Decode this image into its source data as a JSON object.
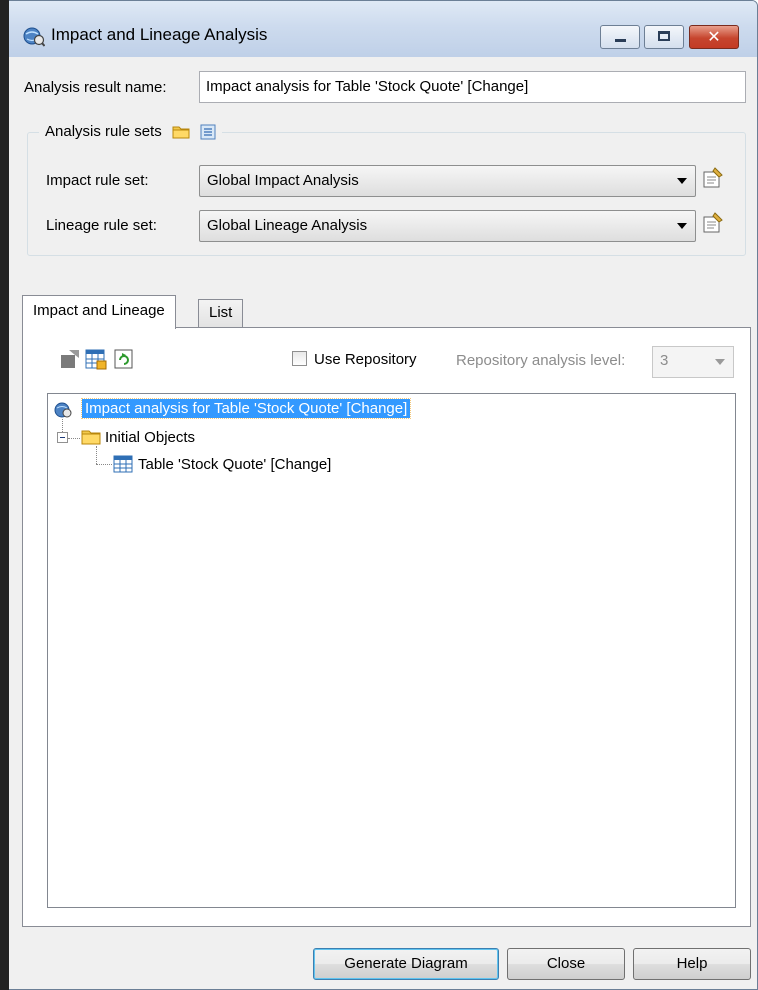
{
  "window": {
    "title": "Impact and Lineage Analysis",
    "close_glyph": "✕"
  },
  "form": {
    "result_name_label": "Analysis result name:",
    "result_name_value": "Impact analysis for Table 'Stock Quote' [Change]",
    "rule_sets_legend": "Analysis rule sets",
    "impact_label": "Impact rule set:",
    "impact_value": "Global Impact Analysis",
    "lineage_label": "Lineage rule set:",
    "lineage_value": "Global Lineage Analysis"
  },
  "tabs": [
    {
      "label": "Impact and Lineage",
      "active": true
    },
    {
      "label": "List",
      "active": false
    }
  ],
  "panel": {
    "use_repository_label": "Use Repository",
    "use_repository_checked": false,
    "repo_level_label": "Repository analysis level:",
    "repo_level_value": "3"
  },
  "tree": {
    "root": "Impact analysis for Table 'Stock Quote' [Change]",
    "child": "Initial Objects",
    "leaf": "Table 'Stock Quote' [Change]"
  },
  "buttons": {
    "generate": "Generate Diagram",
    "close": "Close",
    "help": "Help"
  },
  "colors": {
    "selection": "#3399ff",
    "close_button": "#c6452e",
    "titlebar": "#cddbee"
  }
}
